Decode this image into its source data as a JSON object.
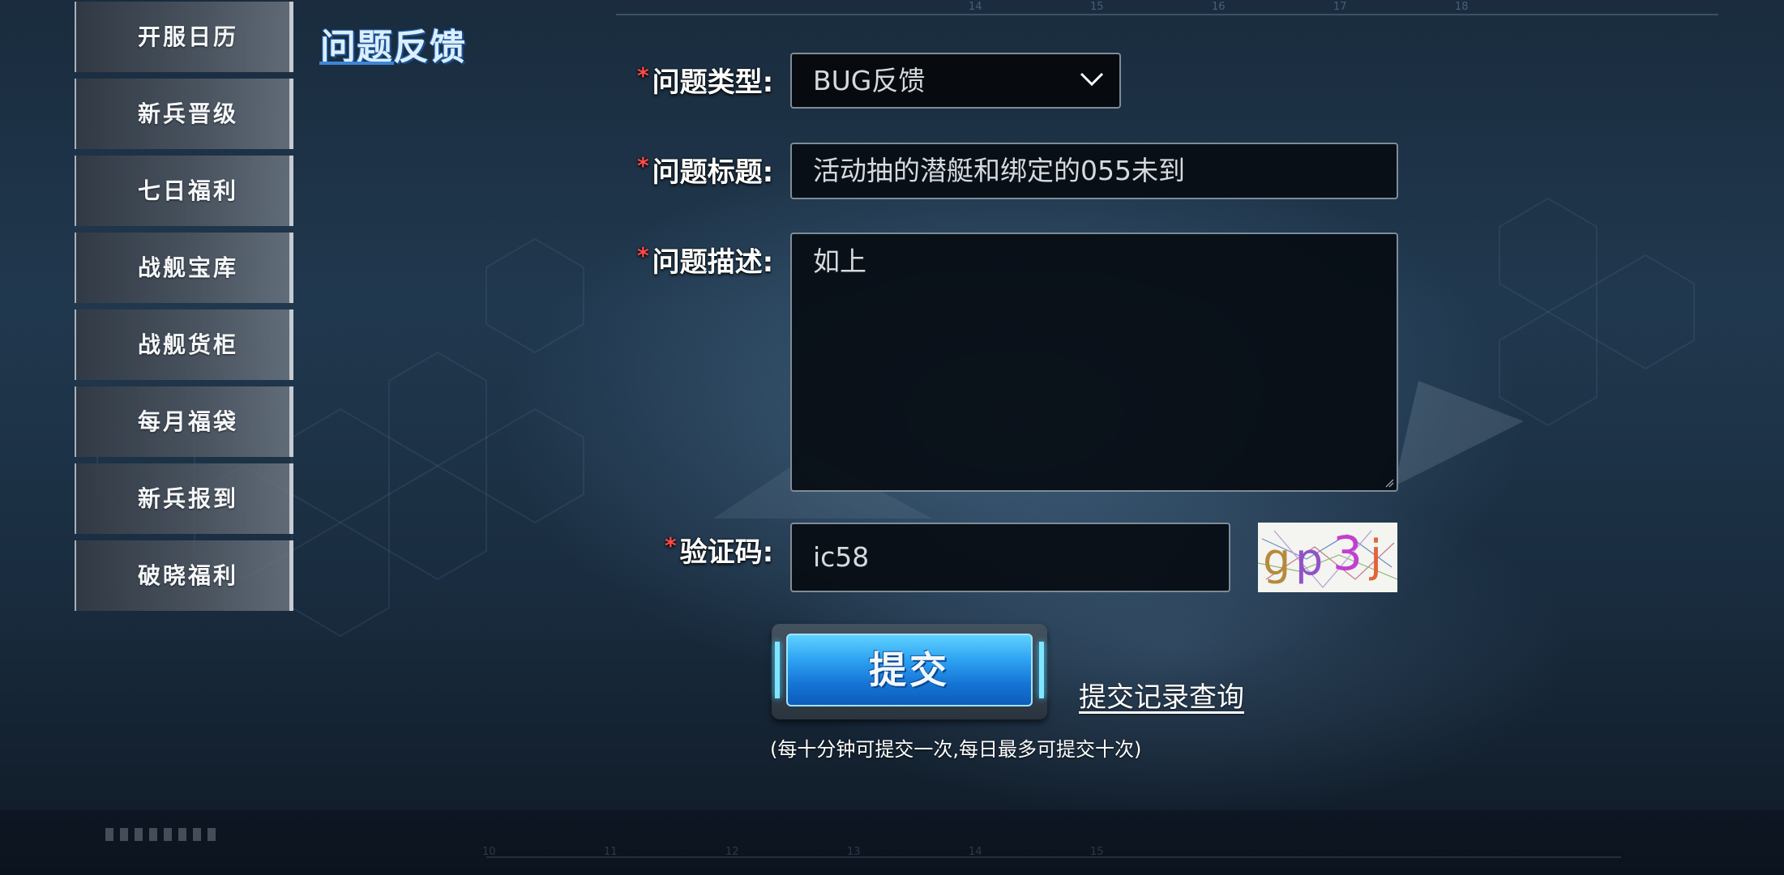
{
  "page_title": "问题反馈",
  "sidebar": {
    "items": [
      {
        "label": "开服日历"
      },
      {
        "label": "新兵晋级"
      },
      {
        "label": "七日福利"
      },
      {
        "label": "战舰宝库"
      },
      {
        "label": "战舰货柜"
      },
      {
        "label": "每月福袋"
      },
      {
        "label": "新兵报到"
      },
      {
        "label": "破晓福利"
      }
    ]
  },
  "form": {
    "required_mark": "*",
    "type_label": "问题类型:",
    "type_value": "BUG反馈",
    "title_label": "问题标题:",
    "title_value": "活动抽的潜艇和绑定的055未到",
    "desc_label": "问题描述:",
    "desc_value": "如上",
    "captcha_label": "验证码:",
    "captcha_value": "ic58",
    "captcha_image_text": "gp3j"
  },
  "actions": {
    "submit_label": "提交",
    "history_link": "提交记录查询",
    "hint": "(每十分钟可提交一次,每日最多可提交十次)"
  },
  "colors": {
    "required": "#ff4a4a",
    "accent_blue": "#2ea3f2"
  }
}
